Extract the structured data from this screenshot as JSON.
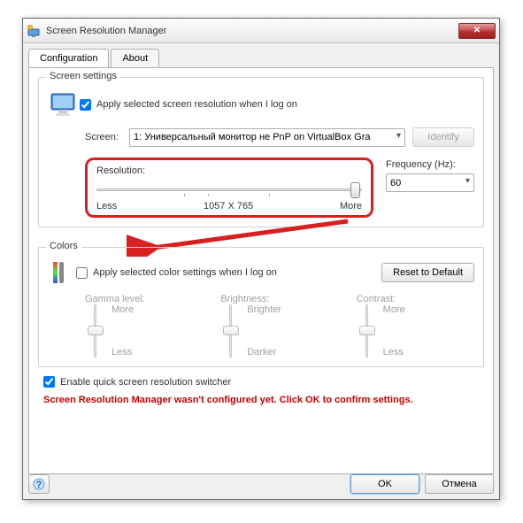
{
  "window": {
    "title": "Screen Resolution Manager"
  },
  "tabs": {
    "config": "Configuration",
    "about": "About"
  },
  "screen": {
    "legend": "Screen settings",
    "apply_logon": "Apply selected screen resolution when I log on",
    "screen_label": "Screen:",
    "screen_value": "1: Универсальный монитор не PnP on VirtualBox Gra",
    "identify": "Identify",
    "resolution_label": "Resolution:",
    "less": "Less",
    "value": "1057 X 765",
    "more": "More",
    "freq_label": "Frequency (Hz):",
    "freq_value": "60"
  },
  "colors": {
    "legend": "Colors",
    "apply_logon": "Apply selected color settings when I log on",
    "reset": "Reset to Default",
    "gamma": "Gamma level:",
    "brightness": "Brightness:",
    "contrast": "Contrast:",
    "more": "More",
    "less": "Less",
    "brighter": "Brighter",
    "darker": "Darker"
  },
  "switcher": "Enable quick screen resolution switcher",
  "warning": "Screen Resolution Manager wasn't configured yet. Click OK to confirm settings.",
  "buttons": {
    "ok": "OK",
    "cancel": "Отмена",
    "help": "?"
  }
}
